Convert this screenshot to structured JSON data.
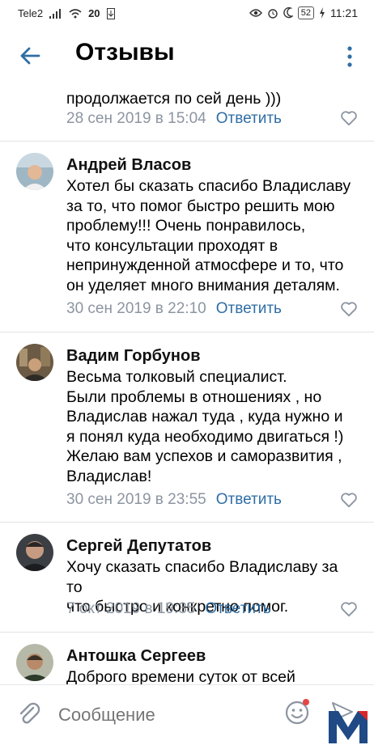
{
  "statusbar": {
    "carrier": "Tele2",
    "network_speed": "20",
    "battery": "52",
    "time": "11:21"
  },
  "header": {
    "title": "Отзывы"
  },
  "comments": [
    {
      "text": "продолжается по сей день )))",
      "date": "28 сен 2019 в 15:04",
      "reply": "Ответить"
    },
    {
      "author": "Андрей Власов",
      "text": "Хотел бы сказать спасибо Владиславу\nза то, что помог быстро решить мою\nпроблему!!! Очень понравилось,\nчто консультации проходят в\nнепринужденной атмосфере и то, что\nон уделяет много внимания деталям.",
      "date": "30 сен 2019 в 22:10",
      "reply": "Ответить"
    },
    {
      "author": "Вадим Горбунов",
      "text": "Весьма толковый специалист.\nБыли проблемы в отношениях , но\nВладислав нажал туда , куда нужно и\nя понял куда необходимо двигаться !)\nЖелаю вам успехов и саморазвития ,\nВладислав!",
      "date": "30 сен 2019 в 23:55",
      "reply": "Ответить"
    },
    {
      "author": "Сергей Депутатов",
      "text": "Хочу сказать спасибо Владиславу за то\nчто быстро и конкретно помог.",
      "date": "7 окт 2019 в 19:35",
      "reply": "Ответить"
    },
    {
      "author": "Антошка Сергеев",
      "text": "Доброго времени суток от всей"
    }
  ],
  "composer": {
    "placeholder": "Сообщение"
  },
  "colors": {
    "accent": "#2f6ea5",
    "secondary_text": "#8c95a1",
    "divider": "#e3e4e8"
  },
  "icons": [
    "back-arrow-icon",
    "more-vertical-icon",
    "heart-icon",
    "paperclip-icon",
    "emoji-icon",
    "send-icon"
  ]
}
